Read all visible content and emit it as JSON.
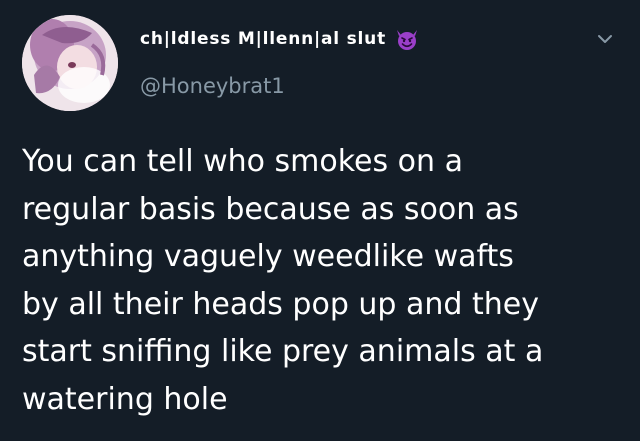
{
  "user": {
    "display_name": "ch|ldless M|llenn|al slut",
    "handle": "@Honeybrat1",
    "badge_icon": "smiling-devil-emoji-icon",
    "avatar_icon": "anime-avatar-image"
  },
  "tweet": {
    "lines": [
      "You can tell who smokes on a",
      "regular basis because as soon as",
      "anything vaguely weedlike wafts",
      "by all their heads pop up and they",
      "start sniffing like prey animals at a",
      "watering hole"
    ]
  },
  "controls": {
    "menu_icon": "chevron-down-icon"
  },
  "colors": {
    "background": "#141d27",
    "text": "#ffffff",
    "secondary_text": "#8899a6",
    "emoji_purple": "#9b3fc9"
  }
}
